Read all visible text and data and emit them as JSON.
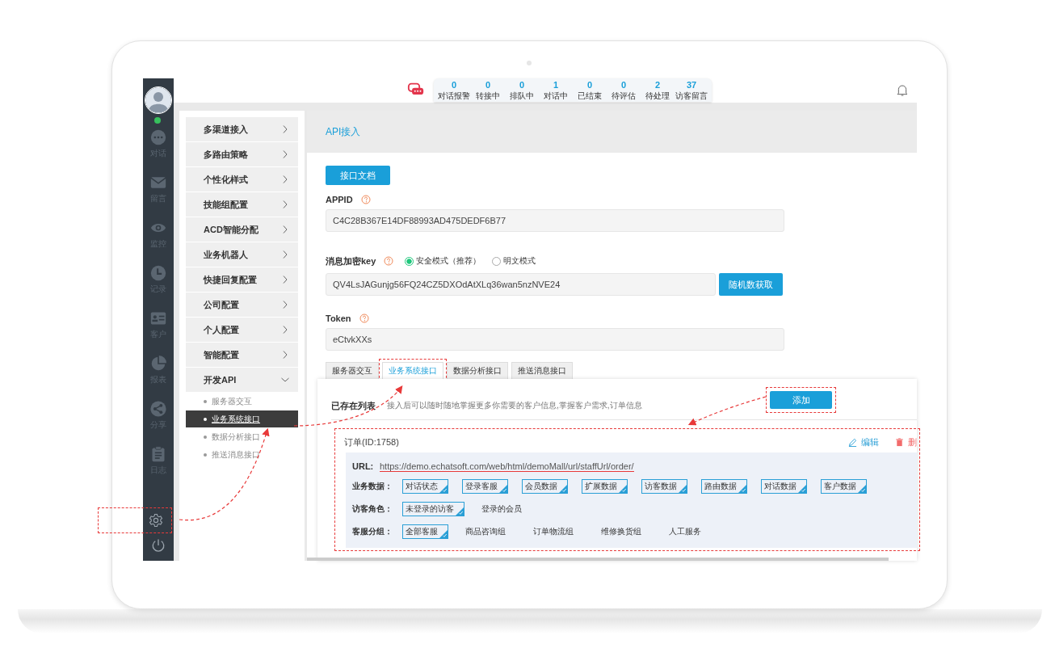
{
  "nav": {
    "avatar": {
      "online": true
    },
    "items": [
      {
        "label": "对话"
      },
      {
        "label": "留言"
      },
      {
        "label": "监控"
      },
      {
        "label": "记录"
      },
      {
        "label": "客户"
      },
      {
        "label": "报表"
      },
      {
        "label": "分享"
      },
      {
        "label": "日志"
      }
    ],
    "bottom": [
      {
        "callout": true
      },
      {
        "callout": false
      }
    ]
  },
  "topbar": {
    "stats": [
      {
        "count": "0",
        "label": "对话报警"
      },
      {
        "count": "0",
        "label": "转接中"
      },
      {
        "count": "0",
        "label": "排队中"
      },
      {
        "count": "1",
        "label": "对话中"
      },
      {
        "count": "0",
        "label": "已结束"
      },
      {
        "count": "0",
        "label": "待评估"
      },
      {
        "count": "2",
        "label": "待处理"
      },
      {
        "count": "37",
        "label": "访客留言"
      }
    ]
  },
  "settings_menu": [
    {
      "label": "多渠道接入",
      "expanded": false
    },
    {
      "label": "多路由策略",
      "expanded": false
    },
    {
      "label": "个性化样式",
      "expanded": false
    },
    {
      "label": "技能组配置",
      "expanded": false
    },
    {
      "label": "ACD智能分配",
      "expanded": false
    },
    {
      "label": "业务机器人",
      "expanded": false
    },
    {
      "label": "快捷回复配置",
      "expanded": false
    },
    {
      "label": "公司配置",
      "expanded": false
    },
    {
      "label": "个人配置",
      "expanded": false
    },
    {
      "label": "智能配置",
      "expanded": false
    },
    {
      "label": "开发API",
      "expanded": true,
      "children": [
        {
          "label": "服务器交互",
          "selected": false
        },
        {
          "label": "业务系统接口",
          "selected": true
        },
        {
          "label": "数据分析接口",
          "selected": false
        },
        {
          "label": "推送消息接口",
          "selected": false
        }
      ]
    }
  ],
  "page": {
    "title": "API接入",
    "doc_button": "接口文档",
    "appid": {
      "label": "APPID",
      "value": "C4C28B367E14DF88993AD475DEDF6B77"
    },
    "key": {
      "label": "消息加密key",
      "modes": [
        {
          "label": "安全模式（推荐）",
          "selected": true
        },
        {
          "label": "明文模式",
          "selected": false
        }
      ],
      "value": "QV4LsJAGunjg56FQ24CZ5DXOdAtXLq36wan5nzNVE24",
      "button": "随机数获取"
    },
    "token": {
      "label": "Token",
      "value": "eCtvkXXs"
    },
    "tabs": [
      {
        "label": "服务器交互",
        "selected": false,
        "callout": false
      },
      {
        "label": "业务系统接口",
        "selected": true,
        "callout": true
      },
      {
        "label": "数据分析接口",
        "selected": false,
        "callout": false
      },
      {
        "label": "推送消息接口",
        "selected": false,
        "callout": false
      }
    ],
    "list": {
      "title": "已存在列表",
      "hint": "接入后可以随时随地掌握更多你需要的客户信息,掌握客户需求,订单信息",
      "add_button": {
        "label": "添加",
        "callout": true
      }
    },
    "records": [
      {
        "title": "订单(ID:1758)",
        "callout": true,
        "edit": "编辑",
        "delete": "删",
        "url_label": "URL:",
        "url": "https://demo.echatsoft.com/web/html/demoMall/url/staffUrl/order/",
        "groups": [
          {
            "label": "业务数据：",
            "options": [
              {
                "label": "对话状态",
                "checked": true
              },
              {
                "label": "登录客服",
                "checked": true
              },
              {
                "label": "会员数据",
                "checked": true
              },
              {
                "label": "扩展数据",
                "checked": true
              },
              {
                "label": "访客数据",
                "checked": true
              },
              {
                "label": "路由数据",
                "checked": true
              },
              {
                "label": "对话数据",
                "checked": true
              },
              {
                "label": "客户数据",
                "checked": true
              }
            ]
          },
          {
            "label": "访客角色：",
            "options": [
              {
                "label": "未登录的访客",
                "checked": true
              },
              {
                "label": "登录的会员",
                "checked": false
              }
            ]
          },
          {
            "label": "客服分组：",
            "options": [
              {
                "label": "全部客服",
                "checked": true
              },
              {
                "label": "商品咨询组",
                "checked": false
              },
              {
                "label": "订单物流组",
                "checked": false
              },
              {
                "label": "维修换货组",
                "checked": false
              },
              {
                "label": "人工服务",
                "checked": false
              }
            ]
          }
        ]
      }
    ]
  }
}
